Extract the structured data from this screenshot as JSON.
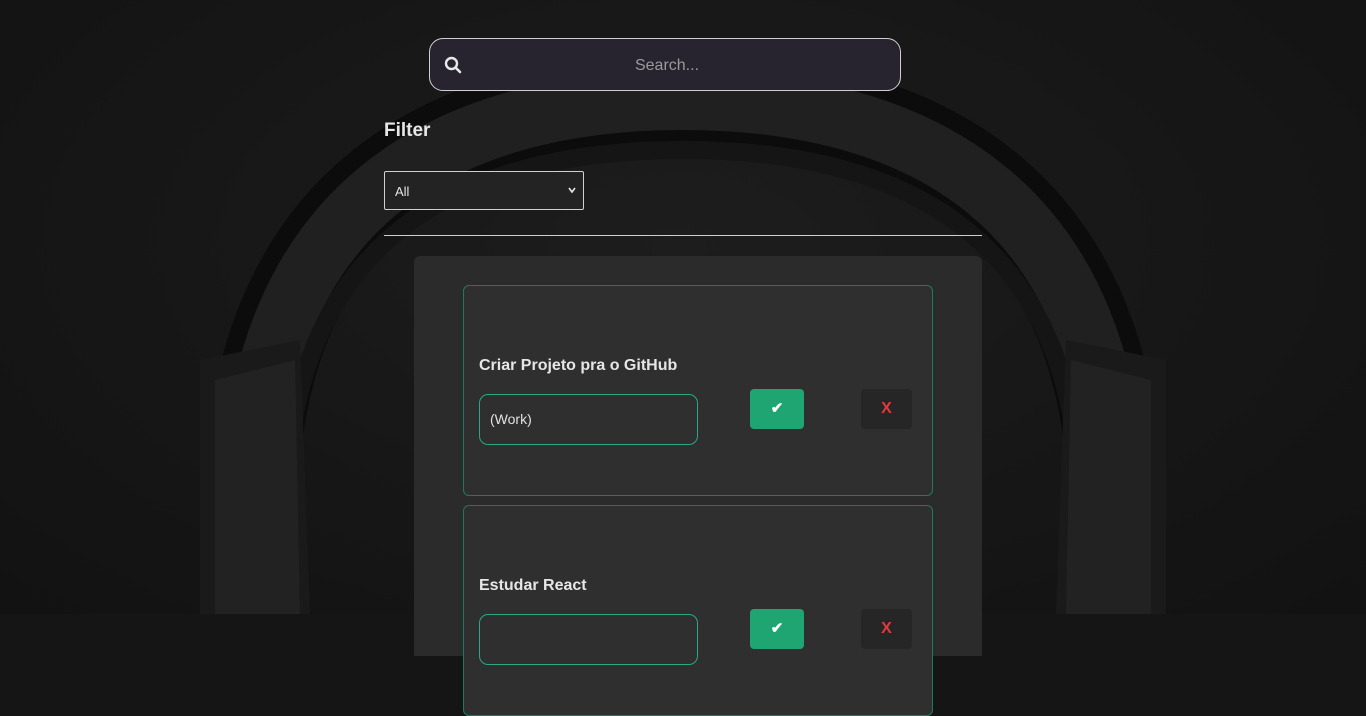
{
  "search": {
    "placeholder": "Search...",
    "icon": "search-icon"
  },
  "filter": {
    "title": "Filter",
    "selected": "All"
  },
  "todos": [
    {
      "title": "Criar Projeto pra o GitHub",
      "category": "(Work)",
      "complete_label": "✔",
      "remove_label": "X"
    },
    {
      "title": "Estudar React",
      "category": "",
      "complete_label": "✔",
      "remove_label": "X"
    }
  ],
  "colors": {
    "accent": "#1fa572",
    "border_accent": "#1d7a5e",
    "remove": "#e03b3b"
  }
}
